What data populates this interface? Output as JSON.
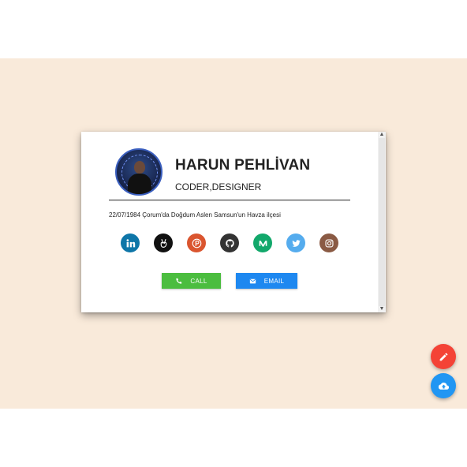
{
  "profile": {
    "name": "HARUN PEHLİVAN",
    "title": "CODER,DESIGNER",
    "bio": "22/07/1984 Çorum'da Doğdum Aslen Samsun'un Havza ilçesi"
  },
  "social_links": [
    {
      "icon": "linkedin-icon",
      "color": "#0e76a8"
    },
    {
      "icon": "angellist-icon",
      "color": "#111111"
    },
    {
      "icon": "producthunt-icon",
      "color": "#da552f"
    },
    {
      "icon": "github-icon",
      "color": "#333333"
    },
    {
      "icon": "medium-icon",
      "color": "#12a86b"
    },
    {
      "icon": "twitter-icon",
      "color": "#55acee"
    },
    {
      "icon": "instagram-icon",
      "color": "#8a5a44"
    }
  ],
  "actions": {
    "call_label": "CALL",
    "email_label": "EMAIL"
  },
  "colors": {
    "background_band": "#f9eada",
    "call": "#4bbd3f",
    "email": "#1e88f0",
    "fab_edit": "#f44336",
    "fab_cloud": "#2196f3"
  },
  "fabs": [
    {
      "icon": "pencil-icon"
    },
    {
      "icon": "cloud-upload-icon"
    }
  ]
}
